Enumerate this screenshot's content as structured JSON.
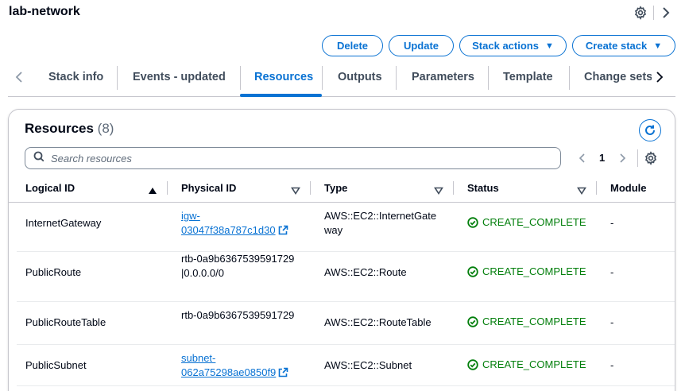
{
  "header": {
    "title": "lab-network"
  },
  "actions": {
    "delete": "Delete",
    "update": "Update",
    "stack_actions": "Stack actions",
    "create_stack": "Create stack"
  },
  "tabs": [
    {
      "label": "Stack info"
    },
    {
      "label": "Events - updated"
    },
    {
      "label": "Resources",
      "active": true
    },
    {
      "label": "Outputs"
    },
    {
      "label": "Parameters"
    },
    {
      "label": "Template"
    },
    {
      "label": "Change sets"
    }
  ],
  "resources": {
    "title": "Resources",
    "count": "(8)",
    "search_placeholder": "Search resources",
    "page": "1",
    "columns": {
      "logical_id": "Logical ID",
      "physical_id": "Physical ID",
      "type": "Type",
      "status": "Status",
      "module": "Module"
    },
    "rows": [
      {
        "logical_id": "InternetGateway",
        "physical_id_line1": "igw-",
        "physical_id_line2": "03047f38a787c1d30",
        "physical_link": true,
        "type": "AWS::EC2::InternetGateway",
        "status": "CREATE_COMPLETE",
        "module": "-"
      },
      {
        "logical_id": "PublicRoute",
        "physical_id": "rtb-0a9b6367539591729|0.0.0.0/0",
        "physical_link": false,
        "type": "AWS::EC2::Route",
        "status": "CREATE_COMPLETE",
        "module": "-"
      },
      {
        "logical_id": "PublicRouteTable",
        "physical_id": "rtb-0a9b6367539591729",
        "physical_link": false,
        "type": "AWS::EC2::RouteTable",
        "status": "CREATE_COMPLETE",
        "module": "-"
      },
      {
        "logical_id": "PublicSubnet",
        "physical_id_line1": "subnet-",
        "physical_id_line2": "062a75298ae0850f9",
        "physical_link": true,
        "type": "AWS::EC2::Subnet",
        "status": "CREATE_COMPLETE",
        "module": "-"
      }
    ]
  },
  "colors": {
    "accent": "#0972d3",
    "success": "#037f0c",
    "text": "#000716",
    "border": "#c6c6cd"
  },
  "icons": {
    "settings": "gear-icon",
    "next": "chevron-right-icon",
    "prev": "chevron-left-icon",
    "refresh": "refresh-icon",
    "search": "search-icon",
    "external": "external-link-icon",
    "status_ok": "check-circle-icon"
  }
}
